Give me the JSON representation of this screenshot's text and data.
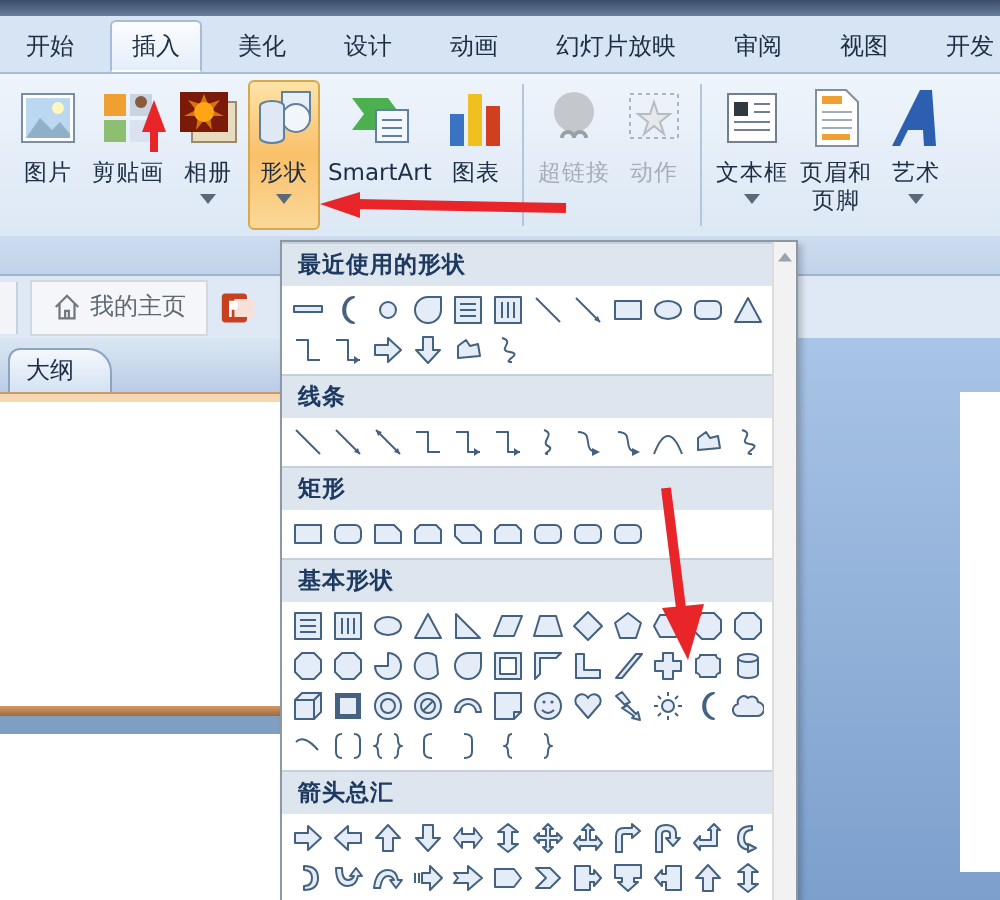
{
  "ribbon_tabs": [
    {
      "label": "开始",
      "selected": false
    },
    {
      "label": "插入",
      "selected": true
    },
    {
      "label": "美化",
      "selected": false
    },
    {
      "label": "设计",
      "selected": false
    },
    {
      "label": "动画",
      "selected": false
    },
    {
      "label": "幻灯片放映",
      "selected": false
    },
    {
      "label": "审阅",
      "selected": false
    },
    {
      "label": "视图",
      "selected": false
    },
    {
      "label": "开发",
      "selected": false
    }
  ],
  "ribbon_groups": [
    {
      "buttons": [
        {
          "label": "图片",
          "dropdown": false,
          "disabled": false,
          "selected": false
        },
        {
          "label": "剪贴画",
          "dropdown": false,
          "disabled": false,
          "selected": false
        },
        {
          "label": "相册",
          "dropdown": true,
          "disabled": false,
          "selected": false
        },
        {
          "label": "形状",
          "dropdown": true,
          "disabled": false,
          "selected": true
        },
        {
          "label": "SmartArt",
          "dropdown": false,
          "disabled": false,
          "selected": false
        },
        {
          "label": "图表",
          "dropdown": false,
          "disabled": false,
          "selected": false
        }
      ]
    },
    {
      "buttons": [
        {
          "label": "超链接",
          "dropdown": false,
          "disabled": true,
          "selected": false
        },
        {
          "label": "动作",
          "dropdown": false,
          "disabled": true,
          "selected": false
        }
      ]
    },
    {
      "buttons": [
        {
          "label": "文本框",
          "dropdown": true,
          "disabled": false,
          "selected": false
        },
        {
          "label": "页眉和页脚",
          "dropdown": false,
          "disabled": false,
          "selected": false
        },
        {
          "label": "艺术",
          "dropdown": true,
          "disabled": false,
          "selected": false
        }
      ]
    }
  ],
  "doc_tabs": [
    {
      "label": "我的主页"
    }
  ],
  "pane_tabs": [
    {
      "label": "大纲"
    }
  ],
  "shape_menu": {
    "sections": [
      {
        "title": "最近使用的形状"
      },
      {
        "title": "线条"
      },
      {
        "title": "矩形"
      },
      {
        "title": "基本形状"
      },
      {
        "title": "箭头总汇"
      }
    ]
  }
}
